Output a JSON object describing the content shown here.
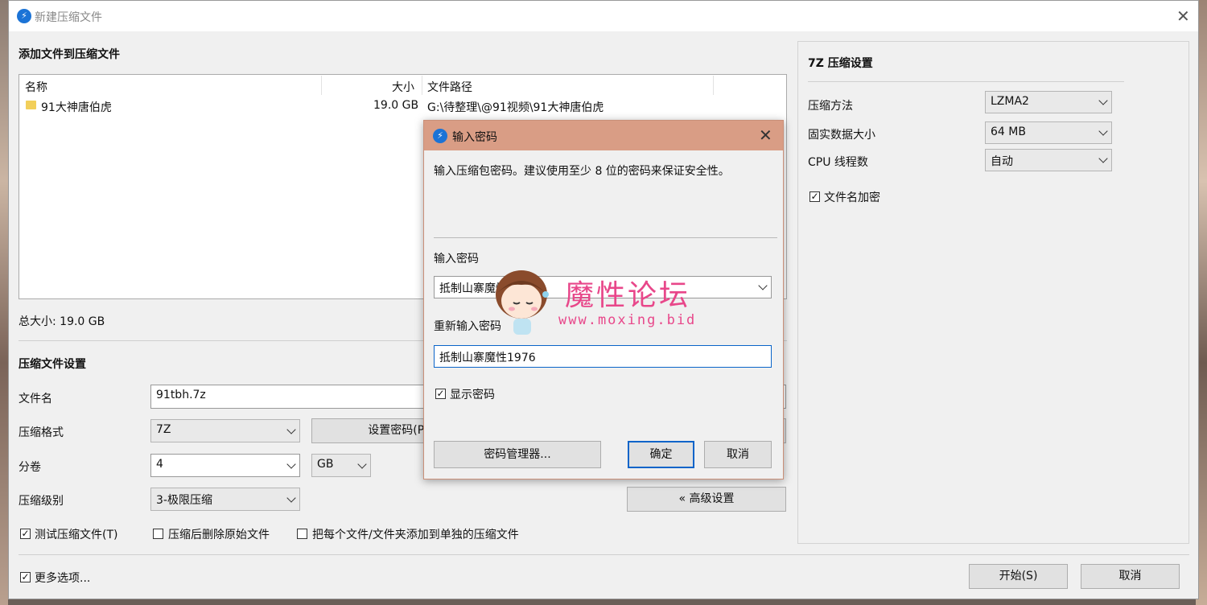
{
  "main_window": {
    "title": "新建压缩文件",
    "add_files_section": "添加文件到压缩文件",
    "columns": [
      "名称",
      "大小",
      "文件路径"
    ],
    "files": [
      {
        "name": "91大神唐伯虎",
        "size": "19.0 GB",
        "path": "G:\\待整理\\@91视频\\91大神唐伯虎"
      }
    ],
    "total_size": "总大小: 19.0 GB",
    "settings_section": "压缩文件设置",
    "filename_label": "文件名",
    "filename_value": "91tbh.7z",
    "format_label": "压缩格式",
    "format_value": "7Z",
    "set_password_button": "设置密码(P)...",
    "volume_label": "分卷",
    "volume_value": "4",
    "volume_unit": "GB",
    "level_label": "压缩级别",
    "level_value": "3-极限压缩",
    "advanced_button": "« 高级设置",
    "test_archive": {
      "label": "测试压缩文件(T)",
      "checked": true
    },
    "delete_after": {
      "label": "压缩后删除原始文件",
      "checked": false
    },
    "separate_archives": {
      "label": "把每个文件/文件夹添加到单独的压缩文件",
      "checked": false
    },
    "more_options": {
      "label": "更多选项...",
      "checked": true
    },
    "start_button": "开始(S)",
    "cancel_button": "取消"
  },
  "seven_z_settings": {
    "title": "7Z 压缩设置",
    "method_label": "压缩方法",
    "method_value": "LZMA2",
    "solid_label": "固实数据大小",
    "solid_value": "64 MB",
    "threads_label": "CPU 线程数",
    "threads_value": "自动",
    "encrypt_names": {
      "label": "文件名加密",
      "checked": true
    }
  },
  "password_dialog": {
    "title": "输入密码",
    "description": "输入压缩包密码。建议使用至少 8 位的密码来保证安全性。",
    "password_label": "输入密码",
    "password_value": "抵制山寨魔性1976",
    "reenter_label": "重新输入密码",
    "reenter_value": "抵制山寨魔性1976",
    "show_password": {
      "label": "显示密码",
      "checked": true
    },
    "manager_button": "密码管理器...",
    "ok_button": "确定",
    "cancel_button": "取消"
  },
  "watermark": {
    "text": "魔性论坛",
    "url": "www.moxing.bid"
  },
  "colors": {
    "dialog_titlebar": "#d99d85",
    "watermark": "#e8478a",
    "app_icon": "#1b73d6"
  }
}
